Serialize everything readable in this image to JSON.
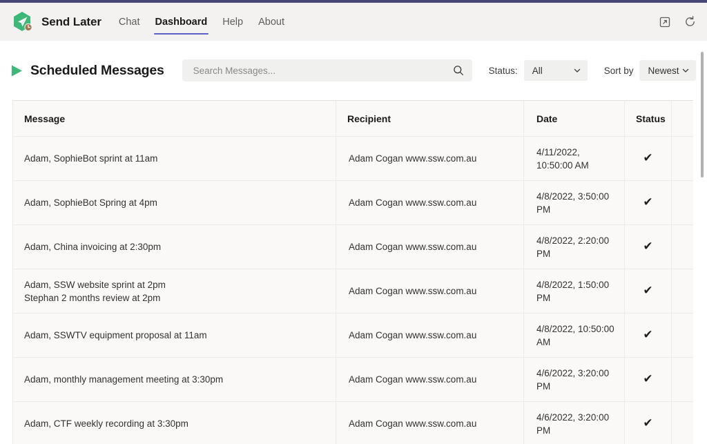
{
  "colors": {
    "accent_purple": "#5b5fc7",
    "top_strip": "#464775",
    "brand_green": "#38b87c",
    "header_bg": "#f3f2f1",
    "table_bg": "#faf9f8",
    "border": "#edebe9"
  },
  "header": {
    "brand_name": "Send Later",
    "logo_icon": "send-later-logo",
    "nav": [
      {
        "label": "Chat",
        "active": false
      },
      {
        "label": "Dashboard",
        "active": true
      },
      {
        "label": "Help",
        "active": false
      },
      {
        "label": "About",
        "active": false
      }
    ],
    "actions": [
      {
        "icon": "popout-icon",
        "label": "Pop out"
      },
      {
        "icon": "refresh-icon",
        "label": "Refresh"
      }
    ]
  },
  "toolbar": {
    "title_icon": "send-arrow-icon",
    "title": "Scheduled Messages",
    "search": {
      "placeholder": "Search Messages...",
      "value": "",
      "icon": "search-icon"
    },
    "status_filter": {
      "label": "Status:",
      "value": "All",
      "options": [
        "All"
      ]
    },
    "sort_filter": {
      "label": "Sort by",
      "value": "Newest",
      "options": [
        "Newest"
      ]
    }
  },
  "table": {
    "columns": [
      {
        "key": "message",
        "label": "Message"
      },
      {
        "key": "recipient",
        "label": "Recipient"
      },
      {
        "key": "date",
        "label": "Date"
      },
      {
        "key": "status",
        "label": "Status"
      },
      {
        "key": "actions",
        "label": ""
      }
    ],
    "rows": [
      {
        "message_lines": [
          "Adam, SophieBot sprint at 11am"
        ],
        "recipient": "Adam Cogan www.ssw.com.au",
        "date": "4/11/2022, 10:50:00 AM",
        "status_icon": "check-icon"
      },
      {
        "message_lines": [
          "Adam, SophieBot Spring at 4pm"
        ],
        "recipient": "Adam Cogan www.ssw.com.au",
        "date": "4/8/2022, 3:50:00 PM",
        "status_icon": "check-icon"
      },
      {
        "message_lines": [
          "Adam, China invoicing at 2:30pm"
        ],
        "recipient": "Adam Cogan www.ssw.com.au",
        "date": "4/8/2022, 2:20:00 PM",
        "status_icon": "check-icon"
      },
      {
        "message_lines": [
          "Adam, SSW website sprint at 2pm",
          "Stephan 2 months review at 2pm"
        ],
        "recipient": "Adam Cogan www.ssw.com.au",
        "date": "4/8/2022, 1:50:00 PM",
        "status_icon": "check-icon"
      },
      {
        "message_lines": [
          "Adam, SSWTV equipment proposal at 11am"
        ],
        "recipient": "Adam Cogan www.ssw.com.au",
        "date": "4/8/2022, 10:50:00 AM",
        "status_icon": "check-icon"
      },
      {
        "message_lines": [
          "Adam, monthly management meeting at 3:30pm"
        ],
        "recipient": "Adam Cogan www.ssw.com.au",
        "date": "4/6/2022, 3:20:00 PM",
        "status_icon": "check-icon"
      },
      {
        "message_lines": [
          "Adam, CTF weekly recording at 3:30pm"
        ],
        "recipient": "Adam Cogan www.ssw.com.au",
        "date": "4/6/2022, 3:20:00 PM",
        "status_icon": "check-icon"
      }
    ],
    "check_glyph": "✔"
  }
}
